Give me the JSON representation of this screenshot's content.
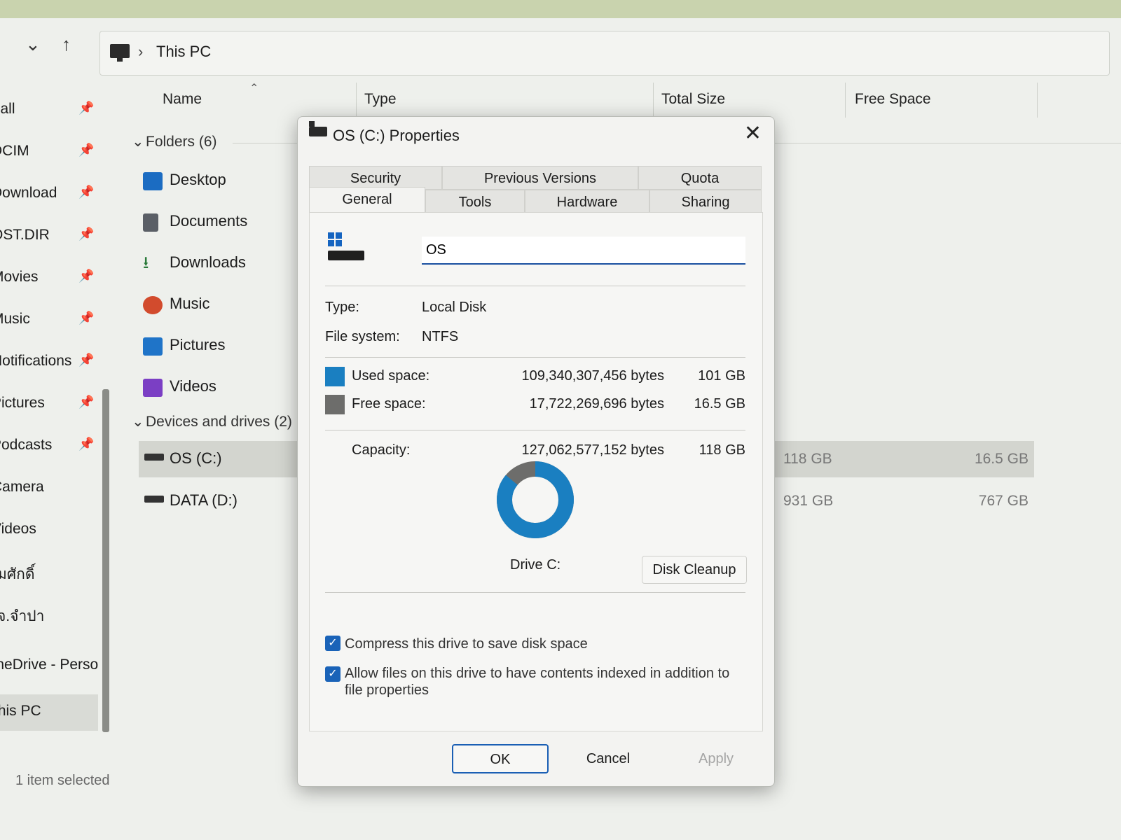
{
  "explorer": {
    "breadcrumb": "This PC",
    "columns": {
      "name": "Name",
      "type": "Type",
      "total": "Total Size",
      "free": "Free Space"
    },
    "sidebar": [
      {
        "label": "call",
        "pinned": true
      },
      {
        "label": "DCIM",
        "pinned": true
      },
      {
        "label": "Download",
        "pinned": true
      },
      {
        "label": "OST.DIR",
        "pinned": true
      },
      {
        "label": "Movies",
        "pinned": true
      },
      {
        "label": "Music",
        "pinned": true
      },
      {
        "label": "Notifications",
        "pinned": true
      },
      {
        "label": "Pictures",
        "pinned": true
      },
      {
        "label": "Podcasts",
        "pinned": true
      },
      {
        "label": "Camera",
        "pinned": false
      },
      {
        "label": "Videos",
        "pinned": false
      },
      {
        "label": "มศักดิ์",
        "pinned": false
      },
      {
        "label": "จ.จำปา",
        "pinned": false
      },
      {
        "label": "OneDrive - Perso",
        "pinned": false
      },
      {
        "label": "This PC",
        "pinned": false
      }
    ],
    "folders_group": "Folders (6)",
    "folders": [
      "Desktop",
      "Documents",
      "Downloads",
      "Music",
      "Pictures",
      "Videos"
    ],
    "drives_group": "Devices and drives (2)",
    "drives": [
      {
        "name": "OS (C:)",
        "total": "118 GB",
        "free": "16.5 GB"
      },
      {
        "name": "DATA (D:)",
        "total": "931 GB",
        "free": "767 GB"
      }
    ],
    "status": "1 item selected"
  },
  "dialog": {
    "title": "OS (C:) Properties",
    "tabs_back": [
      "Security",
      "Previous Versions",
      "Quota"
    ],
    "tabs_front": [
      "General",
      "Tools",
      "Hardware",
      "Sharing"
    ],
    "volume_name": "OS",
    "type_label": "Type:",
    "type_value": "Local Disk",
    "fs_label": "File system:",
    "fs_value": "NTFS",
    "used": {
      "label": "Used space:",
      "bytes": "109,340,307,456 bytes",
      "gb": "101 GB",
      "color": "#1a7fc1"
    },
    "free": {
      "label": "Free space:",
      "bytes": "17,722,269,696 bytes",
      "gb": "16.5 GB",
      "color": "#6d6d6b"
    },
    "capacity": {
      "label": "Capacity:",
      "bytes": "127,062,577,152 bytes",
      "gb": "118 GB"
    },
    "used_fraction": 0.86,
    "drive_caption": "Drive C:",
    "cleanup": "Disk Cleanup",
    "compress_label": "Compress this drive to save disk space",
    "index_label": "Allow files on this drive to have contents indexed in addition to file properties",
    "ok": "OK",
    "cancel": "Cancel",
    "apply": "Apply"
  }
}
